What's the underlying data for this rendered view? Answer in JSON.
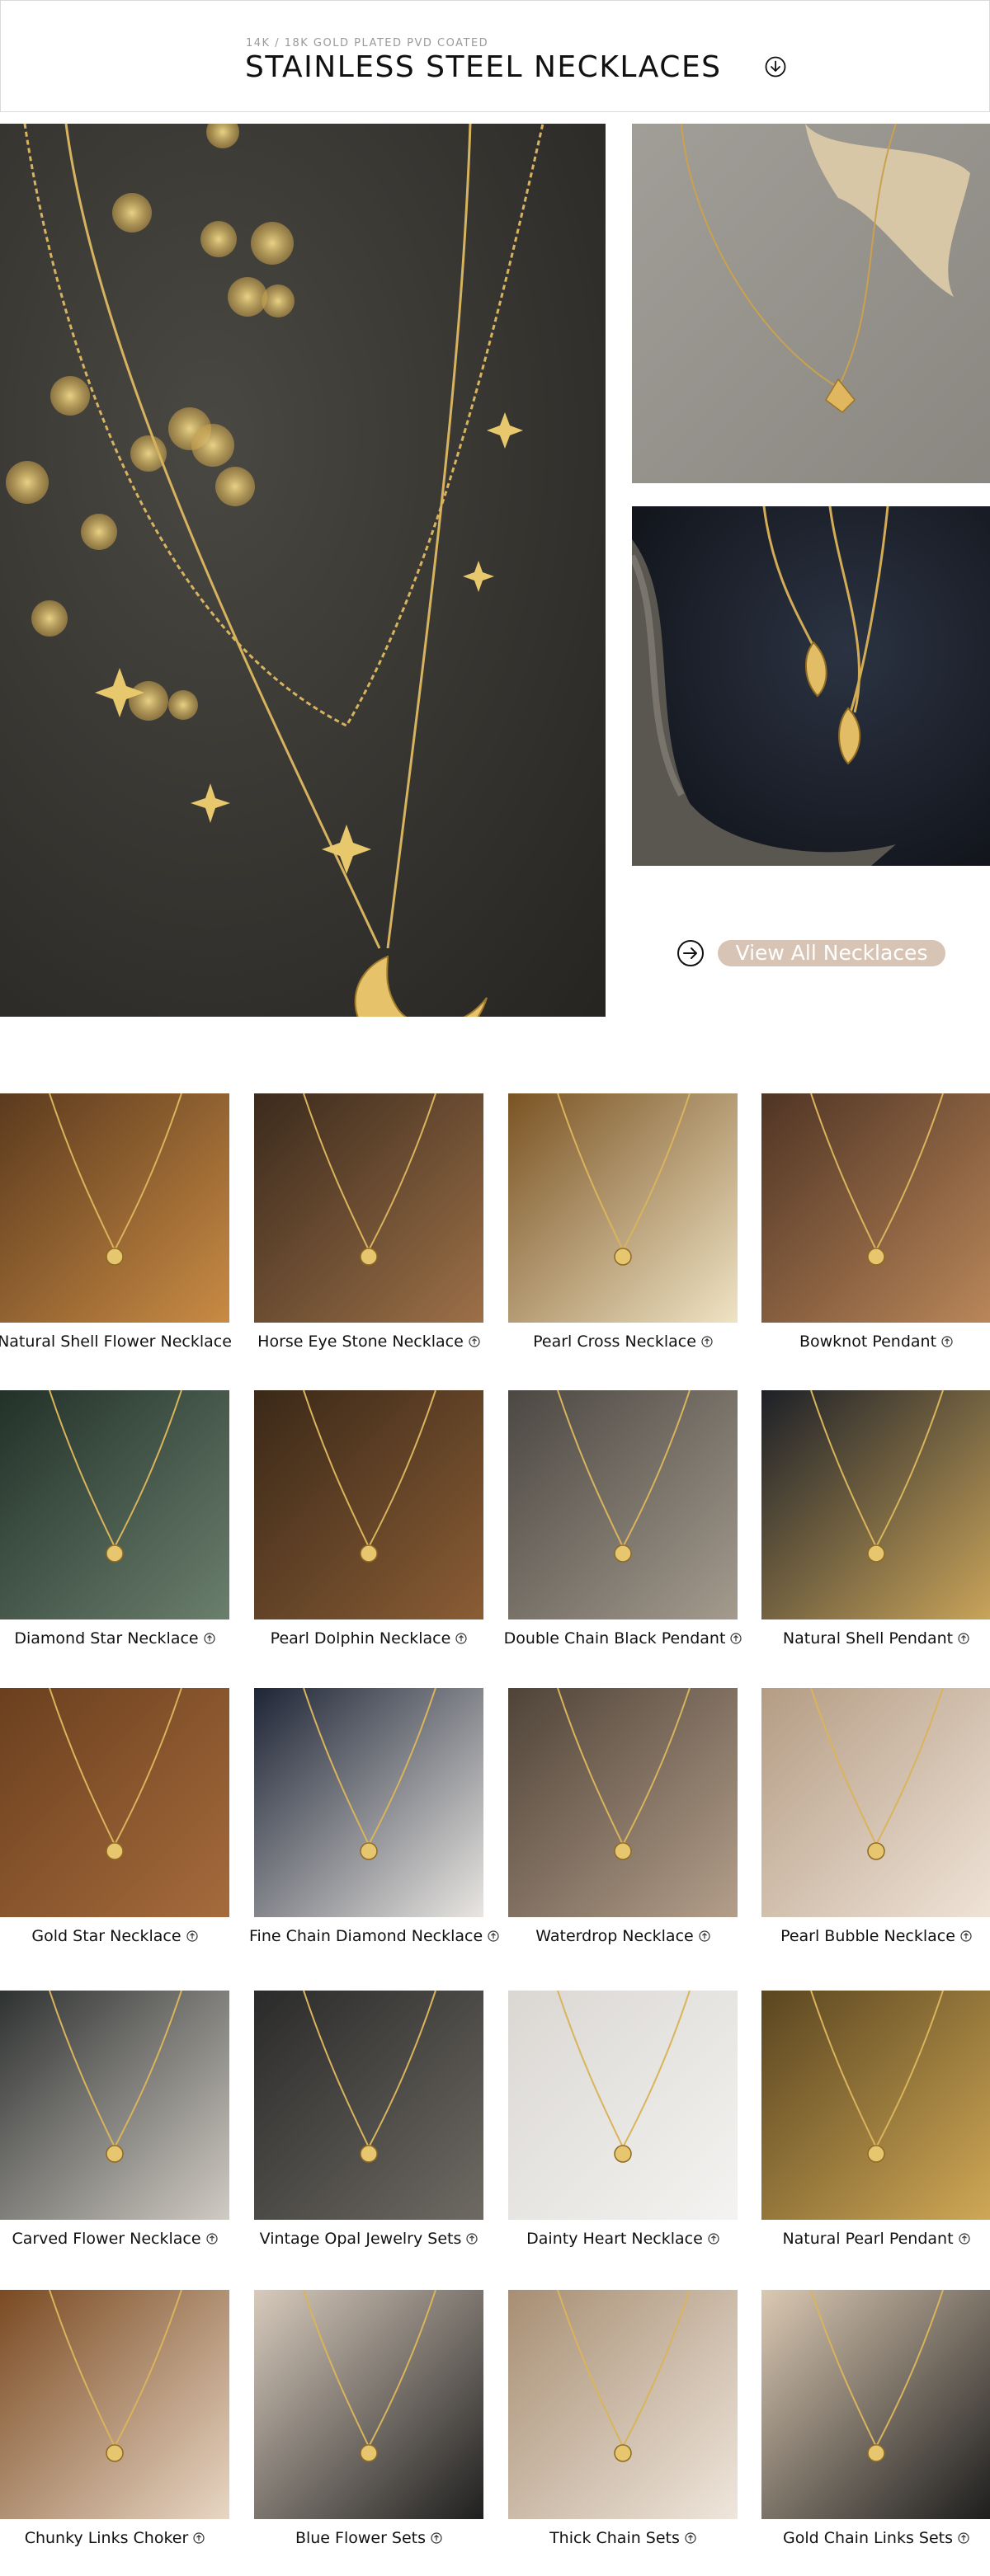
{
  "header": {
    "subtitle": "14K / 18K GOLD PLATED PVD COATED",
    "title": "STAINLESS STEEL NECKLACES",
    "icon": "chevron-down-circle-icon"
  },
  "hero": {
    "view_all_label": "View All Necklaces",
    "view_all_icon": "arrow-right-circle-icon",
    "accent_color": "#d8c4b4"
  },
  "products": [
    {
      "name": "Natural Shell Flower Necklace"
    },
    {
      "name": "Horse Eye Stone Necklace"
    },
    {
      "name": "Pearl Cross Necklace"
    },
    {
      "name": "Bowknot Pendant"
    },
    {
      "name": "Diamond Star Necklace"
    },
    {
      "name": "Pearl Dolphin Necklace"
    },
    {
      "name": "Double Chain Black Pendant"
    },
    {
      "name": "Natural Shell Pendant"
    },
    {
      "name": "Gold Star Necklace"
    },
    {
      "name": "Fine Chain Diamond Necklace"
    },
    {
      "name": "Waterdrop Necklace"
    },
    {
      "name": "Pearl Bubble Necklace"
    },
    {
      "name": "Carved Flower Necklace"
    },
    {
      "name": "Vintage Opal Jewelry Sets"
    },
    {
      "name": "Dainty Heart Necklace"
    },
    {
      "name": "Natural Pearl Pendant"
    },
    {
      "name": "Chunky Links Choker"
    },
    {
      "name": "Blue Flower Sets"
    },
    {
      "name": "Thick Chain Sets"
    },
    {
      "name": "Gold Chain Links Sets"
    }
  ]
}
